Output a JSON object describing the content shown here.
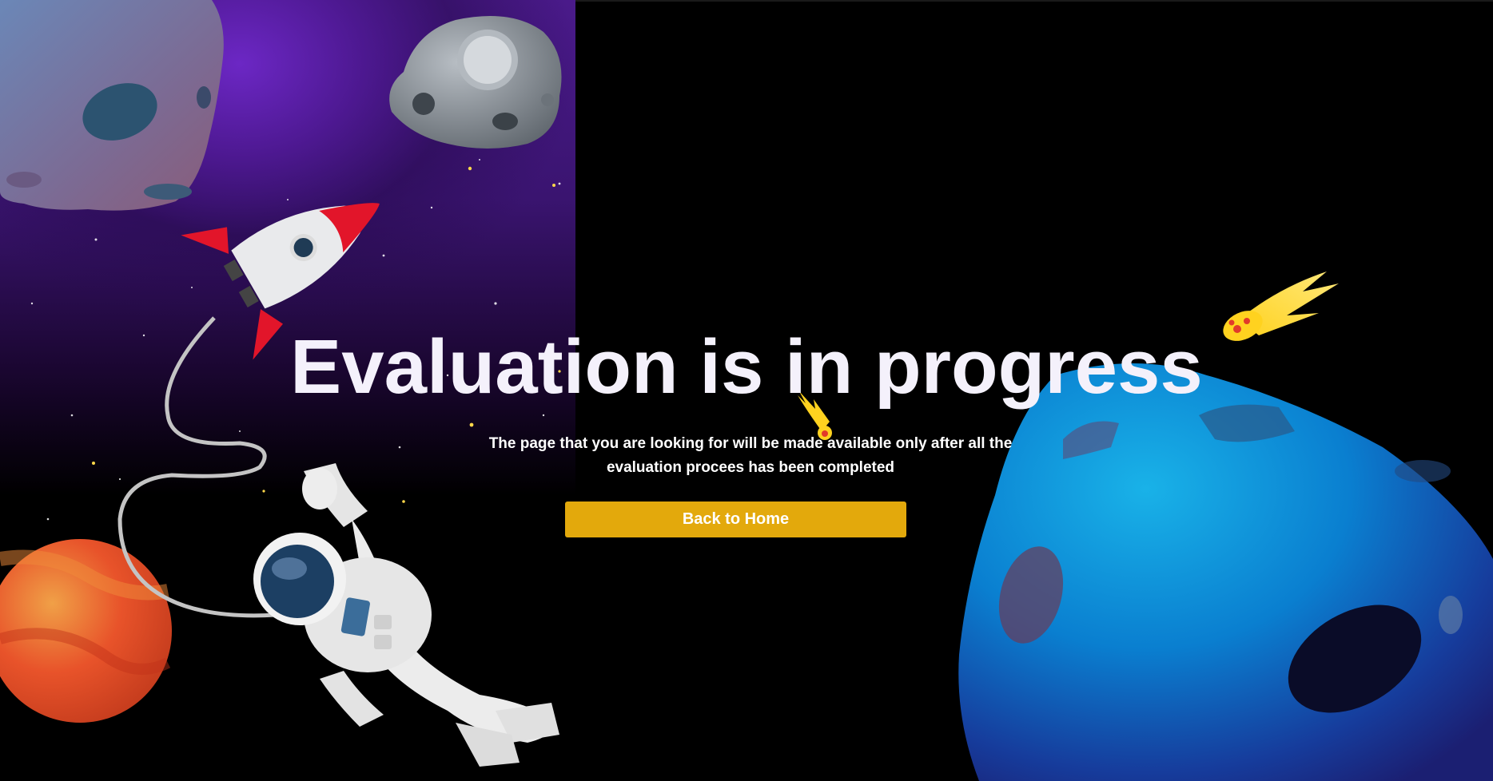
{
  "page": {
    "background_color": "#000000",
    "headline": "Evaluation is in progress",
    "message": "The page that you are looking for will be made available only after all the evaluation procees has been completed",
    "back_button_label": "Back to Home",
    "accent_color": "#e3a90c",
    "headline_color": "#f4f1fb"
  },
  "illustration": {
    "elements": [
      "purple-nebula",
      "asteroid-top-left",
      "asteroid-grey",
      "rocket",
      "tether",
      "astronaut",
      "planet-orange",
      "comet-large",
      "comet-small",
      "planet-blue",
      "stars"
    ],
    "colors": {
      "nebula": "#4a1a8a",
      "rocket_red": "#e2152a",
      "planet_orange": "#e8532a",
      "planet_blue": "#0a6fc2",
      "comet_yellow": "#ffd21f"
    }
  }
}
